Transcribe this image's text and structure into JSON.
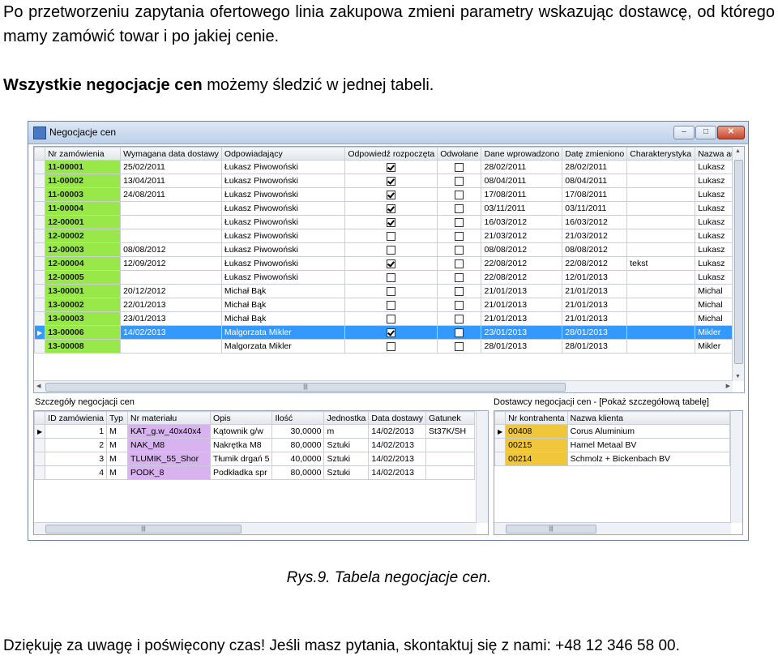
{
  "intro": {
    "p1": "Po przetworzeniu zapytania ofertowego linia zakupowa zmieni parametry wskazując dostawcę, od którego mamy zamówić towar i po jakiej cenie.",
    "p2_bold": "Wszystkie negocjacje cen",
    "p2_rest": " możemy śledzić w jednej tabeli."
  },
  "window": {
    "title": "Negocjacje cen",
    "btn_min": "–",
    "btn_max": "□",
    "btn_close": "✕"
  },
  "main_grid": {
    "columns": [
      "Nr zamówienia",
      "Wymagana data dostawy",
      "Odpowiadający",
      "Odpowiedź rozpoczęta",
      "Odwołane",
      "Dane wprowadzono",
      "Datę zmieniono",
      "Charakterystyka",
      "Nazwa aut"
    ],
    "rows": [
      {
        "nr": "11-00001",
        "wym": "25/02/2011",
        "odp": "Łukasz Piwowoński",
        "roz": true,
        "odw": false,
        "dane": "28/02/2011",
        "zmien": "28/02/2011",
        "char": "",
        "aut": "Lukasz"
      },
      {
        "nr": "11-00002",
        "wym": "13/04/2011",
        "odp": "Łukasz Piwowoński",
        "roz": true,
        "odw": false,
        "dane": "08/04/2011",
        "zmien": "08/04/2011",
        "char": "",
        "aut": "Lukasz"
      },
      {
        "nr": "11-00003",
        "wym": "24/08/2011",
        "odp": "Łukasz Piwowoński",
        "roz": true,
        "odw": false,
        "dane": "17/08/2011",
        "zmien": "17/08/2011",
        "char": "",
        "aut": "Lukasz"
      },
      {
        "nr": "11-00004",
        "wym": "",
        "odp": "Łukasz Piwowoński",
        "roz": true,
        "odw": false,
        "dane": "03/11/2011",
        "zmien": "03/11/2011",
        "char": "",
        "aut": "Lukasz"
      },
      {
        "nr": "12-00001",
        "wym": "",
        "odp": "Łukasz Piwowoński",
        "roz": true,
        "odw": false,
        "dane": "16/03/2012",
        "zmien": "16/03/2012",
        "char": "",
        "aut": "Lukasz"
      },
      {
        "nr": "12-00002",
        "wym": "",
        "odp": "Łukasz Piwowoński",
        "roz": false,
        "odw": false,
        "dane": "21/03/2012",
        "zmien": "21/03/2012",
        "char": "",
        "aut": "Lukasz"
      },
      {
        "nr": "12-00003",
        "wym": "08/08/2012",
        "odp": "Łukasz Piwowoński",
        "roz": false,
        "odw": false,
        "dane": "08/08/2012",
        "zmien": "08/08/2012",
        "char": "",
        "aut": "Lukasz"
      },
      {
        "nr": "12-00004",
        "wym": "12/09/2012",
        "odp": "Łukasz Piwowoński",
        "roz": true,
        "odw": false,
        "dane": "22/08/2012",
        "zmien": "22/08/2012",
        "char": "tekst",
        "aut": "Lukasz"
      },
      {
        "nr": "12-00005",
        "wym": "",
        "odp": "Łukasz Piwowoński",
        "roz": false,
        "odw": false,
        "dane": "22/08/2012",
        "zmien": "12/01/2013",
        "char": "",
        "aut": "Lukasz"
      },
      {
        "nr": "13-00001",
        "wym": "20/12/2012",
        "odp": "Michał Bąk",
        "roz": false,
        "odw": false,
        "dane": "21/01/2013",
        "zmien": "21/01/2013",
        "char": "",
        "aut": "Michal"
      },
      {
        "nr": "13-00002",
        "wym": "22/01/2013",
        "odp": "Michał Bąk",
        "roz": false,
        "odw": false,
        "dane": "21/01/2013",
        "zmien": "21/01/2013",
        "char": "",
        "aut": "Michal"
      },
      {
        "nr": "13-00003",
        "wym": "23/01/2013",
        "odp": "Michał Bąk",
        "roz": false,
        "odw": false,
        "dane": "21/01/2013",
        "zmien": "21/01/2013",
        "char": "",
        "aut": "Michal"
      },
      {
        "nr": "13-00006",
        "wym": "14/02/2013",
        "odp": "Malgorzata Mikler",
        "roz": true,
        "odw": false,
        "dane": "23/01/2013",
        "zmien": "28/01/2013",
        "char": "",
        "aut": "Mikler",
        "selected": true
      },
      {
        "nr": "13-00008",
        "wym": "",
        "odp": "Malgorzata Mikler",
        "roz": false,
        "odw": false,
        "dane": "28/01/2013",
        "zmien": "28/01/2013",
        "char": "",
        "aut": "Mikler"
      }
    ]
  },
  "details": {
    "label": "Szczegóły negocjacji cen",
    "columns": [
      "ID zamówienia",
      "Typ",
      "Nr materiału",
      "Opis",
      "Ilość",
      "Jednostka",
      "Data dostawy",
      "Gatunek"
    ],
    "rows": [
      {
        "id": "1",
        "typ": "M",
        "mat": "KAT_g.w_40x40x4",
        "opis": "Kątownik g/w",
        "ilosc": "30,0000",
        "jedn": "m",
        "data": "14/02/2013",
        "gat": "St37K/SH"
      },
      {
        "id": "2",
        "typ": "M",
        "mat": "NAK_M8",
        "opis": "Nakrętka M8",
        "ilosc": "80,0000",
        "jedn": "Sztuki",
        "data": "14/02/2013",
        "gat": ""
      },
      {
        "id": "3",
        "typ": "M",
        "mat": "TLUMIK_55_Shor",
        "opis": "Tłumik drgań 5",
        "ilosc": "40,0000",
        "jedn": "Sztuki",
        "data": "14/02/2013",
        "gat": ""
      },
      {
        "id": "4",
        "typ": "M",
        "mat": "PODK_8",
        "opis": "Podkładka spr",
        "ilosc": "80,0000",
        "jedn": "Sztuki",
        "data": "14/02/2013",
        "gat": ""
      }
    ]
  },
  "suppliers": {
    "label": "Dostawcy negocjacji cen - [Pokaż szczegółową tabelę]",
    "columns": [
      "Nr kontrahenta",
      "Nazwa klienta"
    ],
    "rows": [
      {
        "nr": "00408",
        "name": "Corus Aluminium"
      },
      {
        "nr": "00215",
        "name": "Hamel Metaal BV"
      },
      {
        "nr": "00214",
        "name": "Schmolz + Bickenbach BV"
      }
    ]
  },
  "caption": "Rys.9. Tabela negocjacje cen.",
  "outro": "Dziękuję za uwagę i poświęcony czas! Jeśli masz pytania, skontaktuj się z nami: +48 12 346 58 00.",
  "colors": {
    "nr_highlight": "#98e84a",
    "selected_row": "#3399ff",
    "material": "#d9b3f0",
    "contractor": "#f0c63a"
  }
}
